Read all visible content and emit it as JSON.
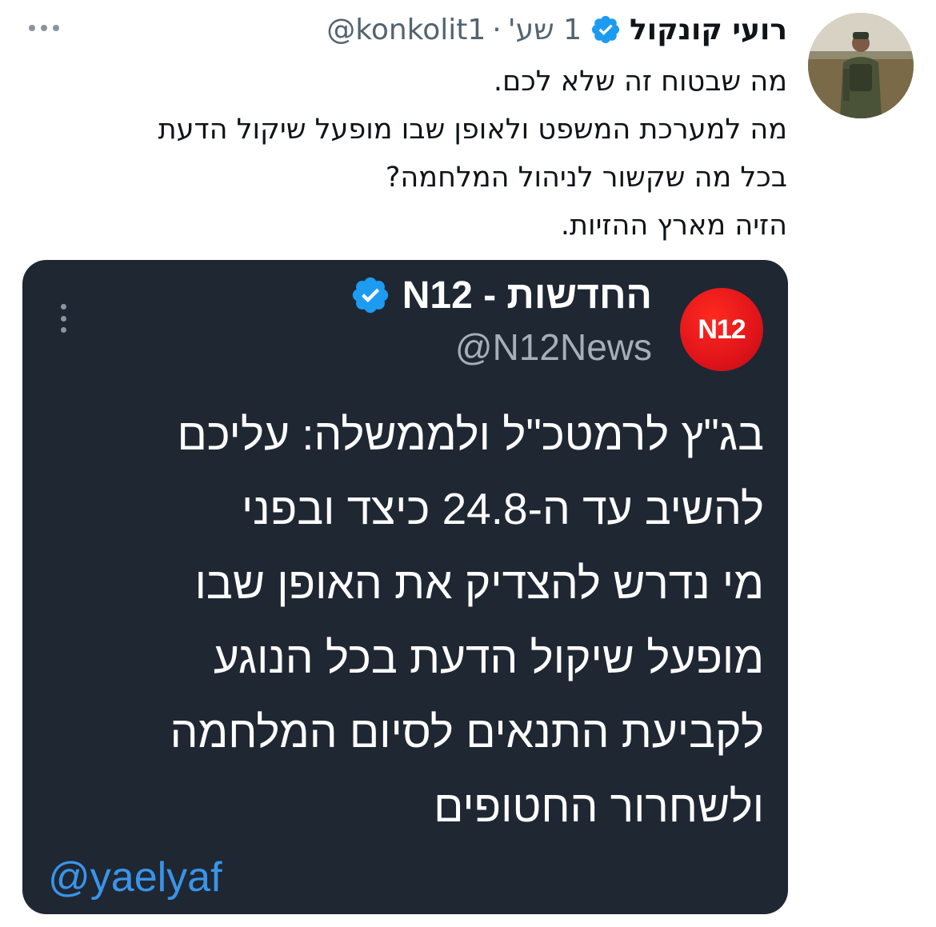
{
  "tweet": {
    "author_name": "רועי קונקול",
    "handle": "@konkolit1",
    "separator": "·",
    "time": "1 שע'",
    "text_lines": [
      "מה שבטוח זה שלא לכם.",
      "מה למערכת המשפט ולאופן שבו מופעל שיקול הדעת",
      "בכל מה שקשור לניהול המלחמה?",
      "הזיה מארץ ההזיות."
    ],
    "avatar_icon": "profile-photo",
    "more_icon": "more-dots-icon",
    "verified_icon": "verified-badge-icon"
  },
  "embedded": {
    "logo_text": "N12",
    "name": "החדשות - N12",
    "handle": "@N12News",
    "body_lines": [
      "בג\"ץ לרמטכ\"ל ולממשלה: עליכם",
      "להשיב עד ה-24.8 כיצד ובפני",
      "מי נדרש להצדיק את האופן שבו",
      "מופעל שיקול הדעת בכל הנוגע",
      "לקביעת התנאים לסיום המלחמה",
      "ולשחרור החטופים"
    ],
    "watermark": "@yaelyaf"
  },
  "colors": {
    "verified_blue": "#1d9bf0",
    "card_bg": "#1f2733",
    "logo_red": "#e0141a",
    "watermark_blue": "#3a94e8",
    "meta_gray": "#536471"
  }
}
